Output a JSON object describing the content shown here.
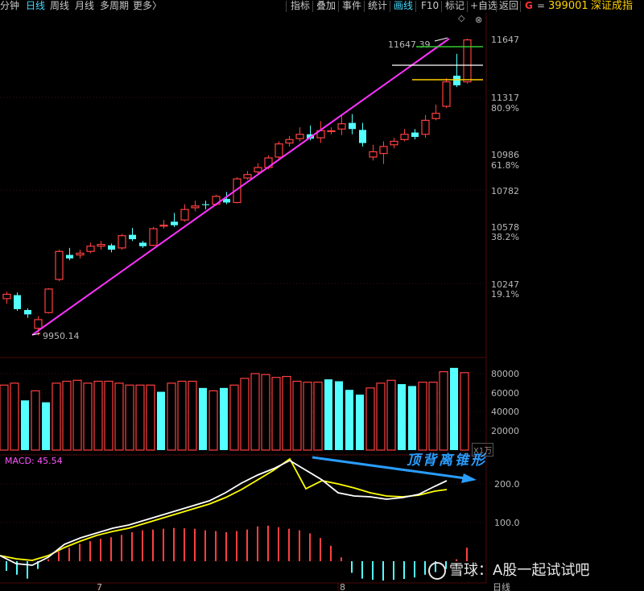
{
  "toolbar": {
    "items": [
      "分钟",
      "日线",
      "周线",
      "月线",
      "多周期",
      "更多〉"
    ],
    "active_index": 1,
    "right_items": [
      "指标",
      "叠加",
      "事件",
      "统计",
      "画线",
      "F10",
      "标记",
      "+自选",
      "返回"
    ],
    "active_right_index": 4,
    "g_mark": "G",
    "separator": "=",
    "stock_code": "399001",
    "stock_name": "深证成指"
  },
  "colors": {
    "up": "#ff4040",
    "down": "#54ffff",
    "trend_line": "#ff33ff",
    "macd_dif": "#ffffff",
    "macd_dea": "#ffff00",
    "arrow": "#2a9dff",
    "grid": "#3a0f0f",
    "support_green": "#33cc33",
    "support_white": "#ffffff",
    "support_yellow": "#ffd000"
  },
  "price_axis": {
    "ticks": [
      "11647",
      "11317",
      "80.9%",
      "10986",
      "61.8%",
      "10782",
      "10578",
      "38.2%",
      "10247",
      "19.1%"
    ]
  },
  "annotations": {
    "high_label": "11647.39",
    "low_label": "9950.14",
    "divergence_label": "顶背离锥形"
  },
  "volume_axis": {
    "ticks": [
      "80000",
      "60000",
      "40000",
      "20000"
    ]
  },
  "macd": {
    "label": "MACD: 45.54",
    "ticks": [
      "200.0",
      "100.0"
    ],
    "mode_label": "X1万"
  },
  "time_axis": {
    "ticks": [
      "7",
      "8"
    ],
    "period_label": "日线"
  },
  "watermark": {
    "text": "雪球：A股一起试试吧"
  },
  "chart_data": {
    "type": "candlestick",
    "price_range": [
      9950.14,
      11647.39
    ],
    "candles": [
      {
        "o": 10160,
        "c": 10185,
        "h": 10200,
        "l": 10130,
        "up": true
      },
      {
        "o": 10180,
        "c": 10100,
        "h": 10195,
        "l": 10090,
        "up": false
      },
      {
        "o": 10095,
        "c": 10070,
        "h": 10105,
        "l": 10050,
        "up": false
      },
      {
        "o": 10040,
        "c": 9990,
        "h": 10060,
        "l": 9950.14,
        "up": true
      },
      {
        "o": 10080,
        "c": 10215,
        "h": 10220,
        "l": 10075,
        "up": true
      },
      {
        "o": 10270,
        "c": 10430,
        "h": 10440,
        "l": 10260,
        "up": true
      },
      {
        "o": 10410,
        "c": 10390,
        "h": 10450,
        "l": 10380,
        "up": false
      },
      {
        "o": 10410,
        "c": 10420,
        "h": 10440,
        "l": 10390,
        "up": true
      },
      {
        "o": 10430,
        "c": 10460,
        "h": 10480,
        "l": 10420,
        "up": true
      },
      {
        "o": 10460,
        "c": 10470,
        "h": 10490,
        "l": 10440,
        "up": true
      },
      {
        "o": 10465,
        "c": 10440,
        "h": 10475,
        "l": 10425,
        "up": false
      },
      {
        "o": 10450,
        "c": 10520,
        "h": 10530,
        "l": 10440,
        "up": true
      },
      {
        "o": 10525,
        "c": 10500,
        "h": 10565,
        "l": 10490,
        "up": false
      },
      {
        "o": 10480,
        "c": 10460,
        "h": 10490,
        "l": 10450,
        "up": false
      },
      {
        "o": 10465,
        "c": 10560,
        "h": 10570,
        "l": 10460,
        "up": true
      },
      {
        "o": 10575,
        "c": 10580,
        "h": 10610,
        "l": 10560,
        "up": true
      },
      {
        "o": 10600,
        "c": 10580,
        "h": 10650,
        "l": 10570,
        "up": false
      },
      {
        "o": 10610,
        "c": 10670,
        "h": 10700,
        "l": 10600,
        "up": true
      },
      {
        "o": 10680,
        "c": 10690,
        "h": 10720,
        "l": 10660,
        "up": true
      },
      {
        "o": 10700,
        "c": 10695,
        "h": 10720,
        "l": 10670,
        "up": false
      },
      {
        "o": 10700,
        "c": 10745,
        "h": 10755,
        "l": 10690,
        "up": true
      },
      {
        "o": 10730,
        "c": 10710,
        "h": 10770,
        "l": 10700,
        "up": false
      },
      {
        "o": 10710,
        "c": 10845,
        "h": 10855,
        "l": 10705,
        "up": true
      },
      {
        "o": 10850,
        "c": 10870,
        "h": 10890,
        "l": 10840,
        "up": true
      },
      {
        "o": 10885,
        "c": 10910,
        "h": 10935,
        "l": 10870,
        "up": true
      },
      {
        "o": 10910,
        "c": 10965,
        "h": 10980,
        "l": 10900,
        "up": true
      },
      {
        "o": 10970,
        "c": 11045,
        "h": 11060,
        "l": 10960,
        "up": true
      },
      {
        "o": 11050,
        "c": 11070,
        "h": 11090,
        "l": 11030,
        "up": true
      },
      {
        "o": 11075,
        "c": 11100,
        "h": 11140,
        "l": 11060,
        "up": true
      },
      {
        "o": 11100,
        "c": 11075,
        "h": 11150,
        "l": 11065,
        "up": false
      },
      {
        "o": 11080,
        "c": 11120,
        "h": 11175,
        "l": 11050,
        "up": true
      },
      {
        "o": 11120,
        "c": 11120,
        "h": 11140,
        "l": 11100,
        "up": true
      },
      {
        "o": 11130,
        "c": 11160,
        "h": 11215,
        "l": 11095,
        "up": true
      },
      {
        "o": 11165,
        "c": 11130,
        "h": 11215,
        "l": 11100,
        "up": false
      },
      {
        "o": 11125,
        "c": 11050,
        "h": 11165,
        "l": 11030,
        "up": false
      },
      {
        "o": 10970,
        "c": 11000,
        "h": 11040,
        "l": 10950,
        "up": true
      },
      {
        "o": 10990,
        "c": 11030,
        "h": 11060,
        "l": 10930,
        "up": true
      },
      {
        "o": 11040,
        "c": 11060,
        "h": 11080,
        "l": 11020,
        "up": true
      },
      {
        "o": 11070,
        "c": 11100,
        "h": 11130,
        "l": 11060,
        "up": true
      },
      {
        "o": 11110,
        "c": 11085,
        "h": 11130,
        "l": 11070,
        "up": false
      },
      {
        "o": 11100,
        "c": 11180,
        "h": 11210,
        "l": 11080,
        "up": true
      },
      {
        "o": 11190,
        "c": 11220,
        "h": 11270,
        "l": 11180,
        "up": true
      },
      {
        "o": 11260,
        "c": 11400,
        "h": 11420,
        "l": 11250,
        "up": true
      },
      {
        "o": 11435,
        "c": 11380,
        "h": 11560,
        "l": 11370,
        "up": false
      },
      {
        "o": 11400,
        "c": 11640,
        "h": 11647.39,
        "l": 11390,
        "up": true
      }
    ],
    "volume": [
      68000,
      70000,
      52000,
      62000,
      50000,
      70000,
      72000,
      73000,
      70000,
      72000,
      72000,
      70000,
      68000,
      68000,
      68000,
      61000,
      70000,
      72000,
      72000,
      65000,
      62000,
      65000,
      68000,
      75000,
      80000,
      79000,
      76000,
      77000,
      72000,
      71000,
      71000,
      74000,
      72000,
      63000,
      58000,
      65000,
      70000,
      73000,
      69000,
      67000,
      71000,
      71000,
      82000,
      86000,
      81000
    ],
    "volume_up": [
      true,
      true,
      false,
      true,
      false,
      true,
      true,
      true,
      true,
      true,
      true,
      true,
      true,
      true,
      true,
      false,
      true,
      true,
      true,
      false,
      true,
      false,
      true,
      true,
      true,
      true,
      true,
      true,
      true,
      true,
      true,
      false,
      false,
      false,
      false,
      true,
      true,
      true,
      false,
      false,
      true,
      true,
      true,
      false,
      true
    ],
    "macd_hist": [
      -25,
      -35,
      -45,
      -20,
      5,
      25,
      35,
      45,
      52,
      58,
      62,
      68,
      75,
      80,
      82,
      84,
      86,
      85,
      84,
      80,
      78,
      75,
      78,
      82,
      90,
      92,
      88,
      84,
      80,
      72,
      60,
      40,
      10,
      -30,
      -45,
      -48,
      -50,
      -48,
      -46,
      -42,
      -35,
      -28,
      -20,
      5,
      35
    ]
  }
}
